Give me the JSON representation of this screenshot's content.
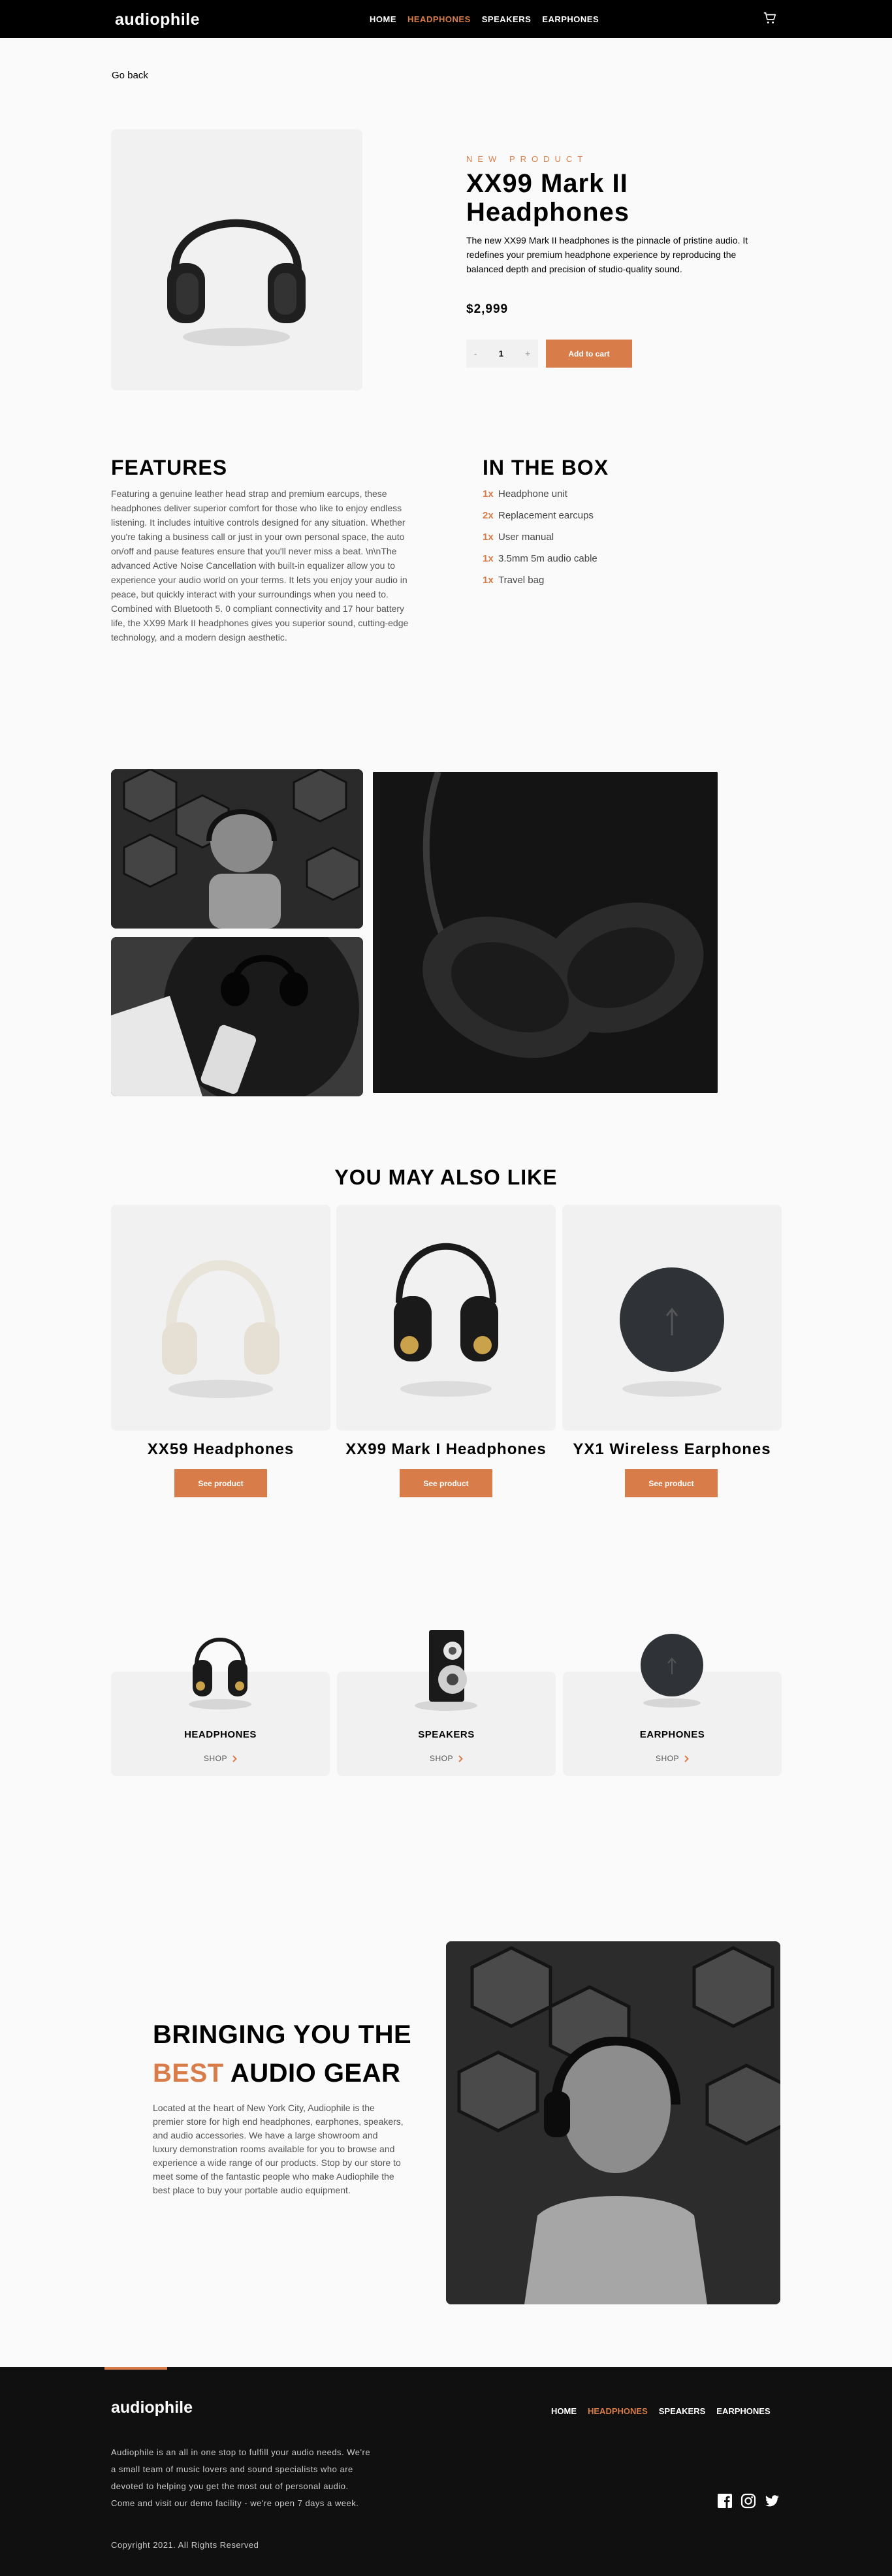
{
  "header": {
    "logo": "audiophile",
    "nav": [
      {
        "label": "HOME",
        "active": false
      },
      {
        "label": "HEADPHONES",
        "active": true
      },
      {
        "label": "SPEAKERS",
        "active": false
      },
      {
        "label": "EARPHONES",
        "active": false
      }
    ],
    "cart_icon": "cart-icon"
  },
  "go_back": "Go back",
  "product": {
    "eyebrow": "NEW PRODUCT",
    "title_line1": "XX99 Mark II",
    "title_line2": "Headphones",
    "description": "The new XX99 Mark II headphones is the pinnacle of pristine audio. It redefines your premium headphone experience by reproducing the balanced depth and precision of studio-quality sound.",
    "price": "$2,999",
    "quantity": {
      "minus": "-",
      "value": "1",
      "plus": "+"
    },
    "add_to_cart": "Add to cart"
  },
  "features": {
    "title": "FEATURES",
    "text": "Featuring a genuine leather head strap and premium earcups, these headphones deliver superior comfort for those who like to enjoy endless listening. It includes intuitive controls designed for any situation. Whether you're taking a business call or just in your own personal space, the auto on/off and pause features ensure that you'll never miss a beat. \\n\\nThe advanced Active Noise Cancellation with built-in equalizer allow you to experience your audio world on your terms. It lets you enjoy your audio in peace, but quickly interact with your surroundings when you need to. Combined with Bluetooth 5. 0 compliant connectivity and 17 hour battery life, the XX99 Mark II headphones gives you superior sound, cutting-edge technology, and a modern design aesthetic."
  },
  "in_the_box": {
    "title": "IN THE BOX",
    "items": [
      {
        "qty": "1x",
        "name": "Headphone unit"
      },
      {
        "qty": "2x",
        "name": "Replacement earcups"
      },
      {
        "qty": "1x",
        "name": "User manual"
      },
      {
        "qty": "1x",
        "name": "3.5mm 5m audio cable"
      },
      {
        "qty": "1x",
        "name": "Travel bag"
      }
    ]
  },
  "also_like": {
    "title": "YOU MAY ALSO LIKE",
    "items": [
      {
        "name": "XX59 Headphones",
        "button": "See product"
      },
      {
        "name": "XX99 Mark I Headphones",
        "button": "See product"
      },
      {
        "name": "YX1 Wireless Earphones",
        "button": "See product"
      }
    ]
  },
  "categories": [
    {
      "name": "HEADPHONES",
      "shop": "SHOP"
    },
    {
      "name": "SPEAKERS",
      "shop": "SHOP"
    },
    {
      "name": "EARPHONES",
      "shop": "SHOP"
    }
  ],
  "about": {
    "head_line1": "BRINGING YOU THE",
    "head_accent": "BEST",
    "head_rest": " AUDIO GEAR",
    "text": "Located at the heart of New York City, Audiophile is the premier store for high end headphones, earphones, speakers, and audio accessories. We have a large showroom and luxury demonstration rooms available for you to browse and experience a wide range of our products. Stop by our store to meet some of the fantastic people who make Audiophile the best place to buy your portable audio equipment."
  },
  "footer": {
    "logo": "audiophile",
    "nav": [
      {
        "label": "HOME",
        "active": false
      },
      {
        "label": "HEADPHONES",
        "active": true
      },
      {
        "label": "SPEAKERS",
        "active": false
      },
      {
        "label": "EARPHONES",
        "active": false
      }
    ],
    "about": "Audiophile is an all in one stop to fulfill your audio needs. We're a small team of music lovers and sound specialists who are devoted to helping you get the most out of personal audio. Come and visit our demo facility - we're open 7 days a week.",
    "copyright": "Copyright 2021. All Rights Reserved",
    "social_icons": [
      "facebook-icon",
      "instagram-icon",
      "twitter-icon"
    ]
  },
  "colors": {
    "accent": "#d87d4a",
    "dark": "#101010",
    "light_gray": "#f1f1f1"
  }
}
